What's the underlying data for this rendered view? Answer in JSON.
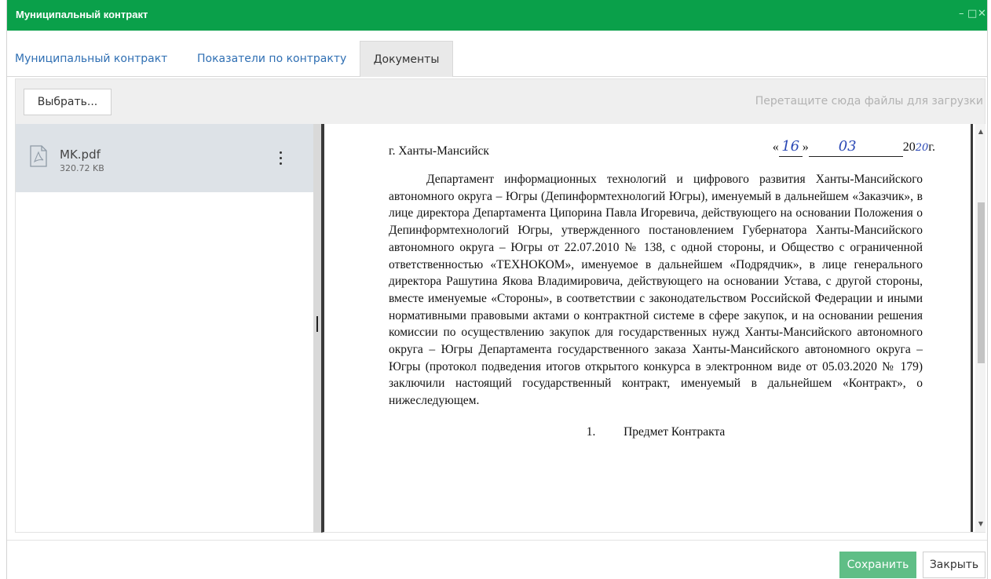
{
  "window": {
    "title": "Муниципальный контракт",
    "controls": {
      "minimize": "–",
      "maximize": "□",
      "close": "✕"
    }
  },
  "tabs": [
    {
      "label": "Муниципальный контракт",
      "active": false
    },
    {
      "label": "Показатели по контракту",
      "active": false
    },
    {
      "label": "Документы",
      "active": true
    }
  ],
  "toolbar": {
    "choose_label": "Выбрать...",
    "drop_hint": "Перетащите сюда файлы для загрузки"
  },
  "files": [
    {
      "name": "MK.pdf",
      "size": "320.72 KB",
      "icon": "pdf-file-icon"
    }
  ],
  "document": {
    "city": "г. Ханты-Мансийск",
    "date": {
      "open_quote": "«",
      "day": "16",
      "close_quote": "»",
      "month": "03",
      "year_prefix": "20",
      "year_hand": "20",
      "year_suffix": "г."
    },
    "paragraph": "Департамент информационных технологий и цифрового развития Ханты-Мансийского автономного округа – Югры (Депинформтехнологий Югры), именуемый в дальнейшем «Заказчик», в лице директора Департамента Ципорина Павла Игоревича, действующего на основании Положения о Депинформтехнологий Югры, утвержденного постановлением Губернатора Ханты-Мансийского автономного округа – Югры от 22.07.2010 № 138, с одной стороны, и Общество с ограниченной ответственностью «ТЕХНОКОМ», именуемое в дальнейшем «Подрядчик», в лице генерального директора Рашутина Якова Владимировича, действующего на основании Устава, с другой стороны, вместе именуемые «Стороны», в соответствии с законодательством Российской Федерации и иными нормативными правовыми актами о контрактной системе в сфере закупок, и на основании решения комиссии по осуществлению закупок для государственных нужд Ханты-Мансийского автономного округа – Югры Департамента государственного заказа Ханты-Мансийского автономного округа – Югры (протокол подведения итогов открытого конкурса в электронном виде от 05.03.2020 № 179) заключили настоящий государственный контракт, именуемый в дальнейшем «Контракт», о нижеследующем.",
    "section_number": "1.",
    "section_title": "Предмет Контракта"
  },
  "footer": {
    "save_label": "Сохранить",
    "close_label": "Закрыть"
  },
  "colors": {
    "titlebar": "#0aa04a",
    "tab_link": "#2f6fb3",
    "save_button": "#5fbe86",
    "handwriting": "#2a48b5"
  }
}
